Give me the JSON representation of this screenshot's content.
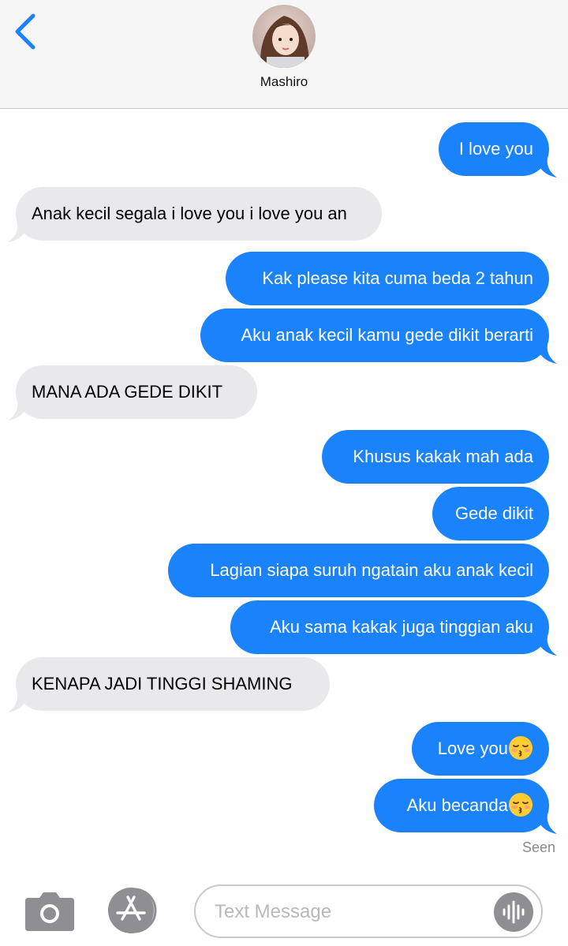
{
  "header": {
    "contact_name": "Mashiro"
  },
  "messages": [
    {
      "side": "sent",
      "text": "I love you"
    },
    {
      "side": "received",
      "text": "Anak kecil segala i love you i love you an"
    },
    {
      "side": "sent",
      "text": "Kak please kita cuma beda 2 tahun"
    },
    {
      "side": "sent",
      "text": "Aku anak kecil kamu gede dikit berarti"
    },
    {
      "side": "received",
      "text": "MANA ADA GEDE DIKIT"
    },
    {
      "side": "sent",
      "text": "Khusus kakak mah ada"
    },
    {
      "side": "sent",
      "text": "Gede dikit"
    },
    {
      "side": "sent",
      "text": "Lagian siapa suruh ngatain aku anak kecil"
    },
    {
      "side": "sent",
      "text": "Aku sama kakak juga tinggian aku"
    },
    {
      "side": "received",
      "text": "KENAPA JADI TINGGI SHAMING"
    },
    {
      "side": "sent",
      "text": "Love you",
      "emoji": "kissing-face-with-closed-eyes"
    },
    {
      "side": "sent",
      "text": "Aku becanda",
      "emoji": "kissing-face-with-closed-eyes"
    }
  ],
  "status": {
    "seen_label": "Seen"
  },
  "input_bar": {
    "placeholder": "Text Message"
  },
  "colors": {
    "accent": "#1a82fb",
    "sent_bubble": "#1a82fb",
    "received_bubble": "#e9e9eb",
    "icon_gray": "#8e8e93"
  }
}
